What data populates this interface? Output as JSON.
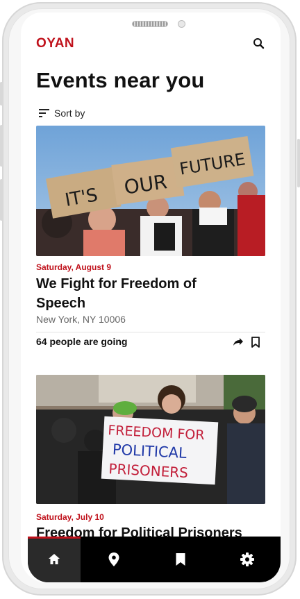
{
  "app": {
    "brand": "OYAN"
  },
  "header": {
    "title": "Events near you",
    "sort_label": "Sort by"
  },
  "events": [
    {
      "date": "Saturday, August 9",
      "title": "We Fight for Freedom of Speech",
      "location": "New York, NY 10006",
      "going": "64 people are going",
      "image_signs": [
        "IT'S",
        "OUR",
        "FUTURE"
      ]
    },
    {
      "date": "Saturday, July 10",
      "title": "Freedom for Political Prisoners",
      "image_signs": [
        "FREEDOM FOR",
        "POLITICAL",
        "PRISONERS"
      ]
    }
  ],
  "nav": {
    "items": [
      "home-icon",
      "location-pin-icon",
      "bookmark-icon",
      "settings-icon"
    ],
    "active": "home-icon"
  },
  "colors": {
    "accent": "#c0121c",
    "text": "#111111",
    "muted": "#666666",
    "nav_bg": "#000000"
  }
}
